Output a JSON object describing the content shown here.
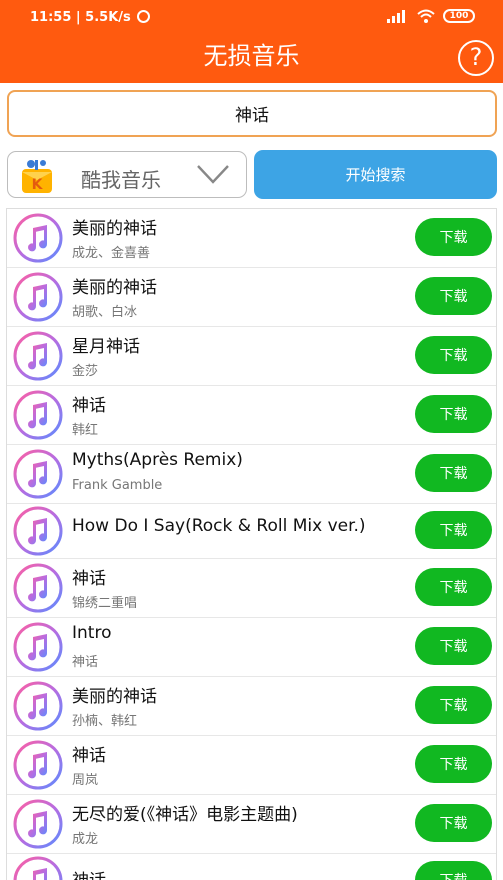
{
  "status": {
    "time": "11:55 | 5.5K/s",
    "battery": "100"
  },
  "header": {
    "title": "无损音乐",
    "help_glyph": "?"
  },
  "search": {
    "query": "神话"
  },
  "source": {
    "selected": "酷我音乐",
    "logo_letter": "K"
  },
  "actions": {
    "search_label": "开始搜索"
  },
  "download_label": "下载",
  "songs": [
    {
      "title": "美丽的神话",
      "artist": "成龙、金喜善"
    },
    {
      "title": "美丽的神话",
      "artist": "胡歌、白冰"
    },
    {
      "title": "星月神话",
      "artist": "金莎"
    },
    {
      "title": "神话",
      "artist": "韩红"
    },
    {
      "title": "Myths(Après Remix)",
      "artist": "Frank Gamble"
    },
    {
      "title": "How Do I Say(Rock & Roll Mix ver.)",
      "artist": ""
    },
    {
      "title": "神话",
      "artist": "锦绣二重唱"
    },
    {
      "title": "Intro",
      "artist": "神话"
    },
    {
      "title": "美丽的神话",
      "artist": "孙楠、韩红"
    },
    {
      "title": "神话",
      "artist": "周岚"
    },
    {
      "title": "无尽的爱(《神话》电影主题曲)",
      "artist": "成龙"
    },
    {
      "title": "神话",
      "artist": ""
    }
  ],
  "colors": {
    "header": "#ff5a0f",
    "search_button": "#3da4e5",
    "download_button": "#11b821",
    "search_border": "#f0a354"
  }
}
